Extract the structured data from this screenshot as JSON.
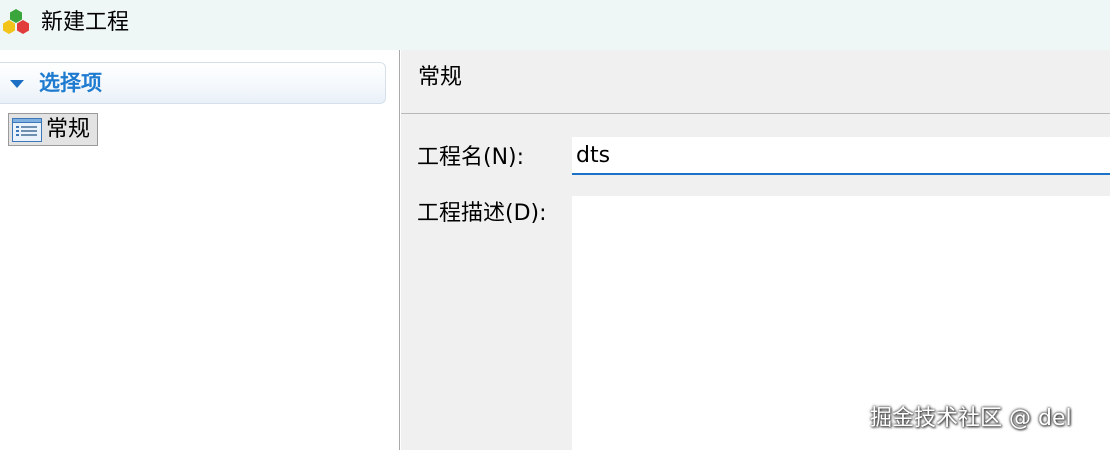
{
  "window": {
    "title": "新建工程",
    "app_icon": "colored-hexagons-icon"
  },
  "sidebar": {
    "section_title": "选择项",
    "collapse_icon": "triangle-down-icon",
    "items": [
      {
        "label": "常规",
        "icon": "list-icon",
        "selected": true
      }
    ]
  },
  "main": {
    "page_title": "常规",
    "fields": {
      "name": {
        "label": "工程名(N):",
        "value": "dts"
      },
      "description": {
        "label": "工程描述(D):",
        "value": ""
      }
    }
  },
  "watermark": "掘金技术社区 @ del",
  "colors": {
    "titlebar_bg": "#eef6f6",
    "accent": "#1e7bd0",
    "input_underline": "#1c72c6",
    "panel_bg": "#f0f0f0"
  }
}
